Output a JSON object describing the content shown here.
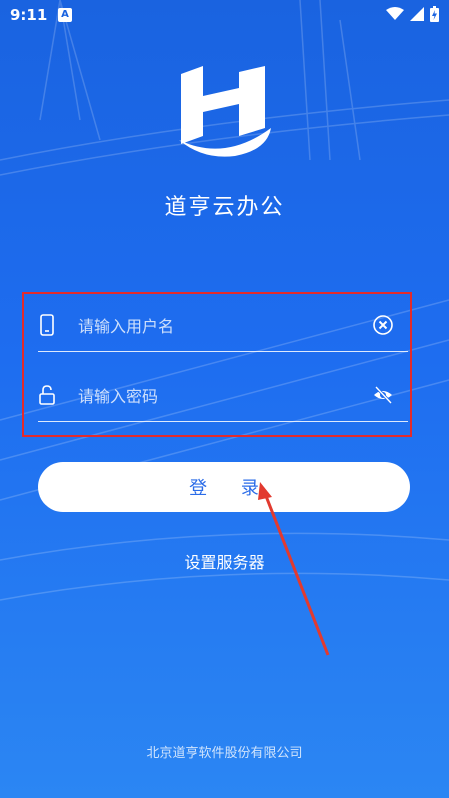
{
  "status_bar": {
    "time": "9:11",
    "notification_badge": "A",
    "icons": [
      "wifi-icon",
      "signal-icon",
      "battery-charging-icon"
    ]
  },
  "app": {
    "logo": "H",
    "title": "道亨云办公"
  },
  "login_form": {
    "username_placeholder": "请输入用户名",
    "username_value": "",
    "password_placeholder": "请输入密码",
    "password_value": "",
    "login_button": "登 录",
    "server_settings": "设置服务器"
  },
  "footer": {
    "company": "北京道亨软件股份有限公司"
  },
  "colors": {
    "background_top": "#1a63e0",
    "background_bottom": "#2b86f3",
    "button_text": "#2b6ce8",
    "highlight_box": "#e32b2b"
  }
}
